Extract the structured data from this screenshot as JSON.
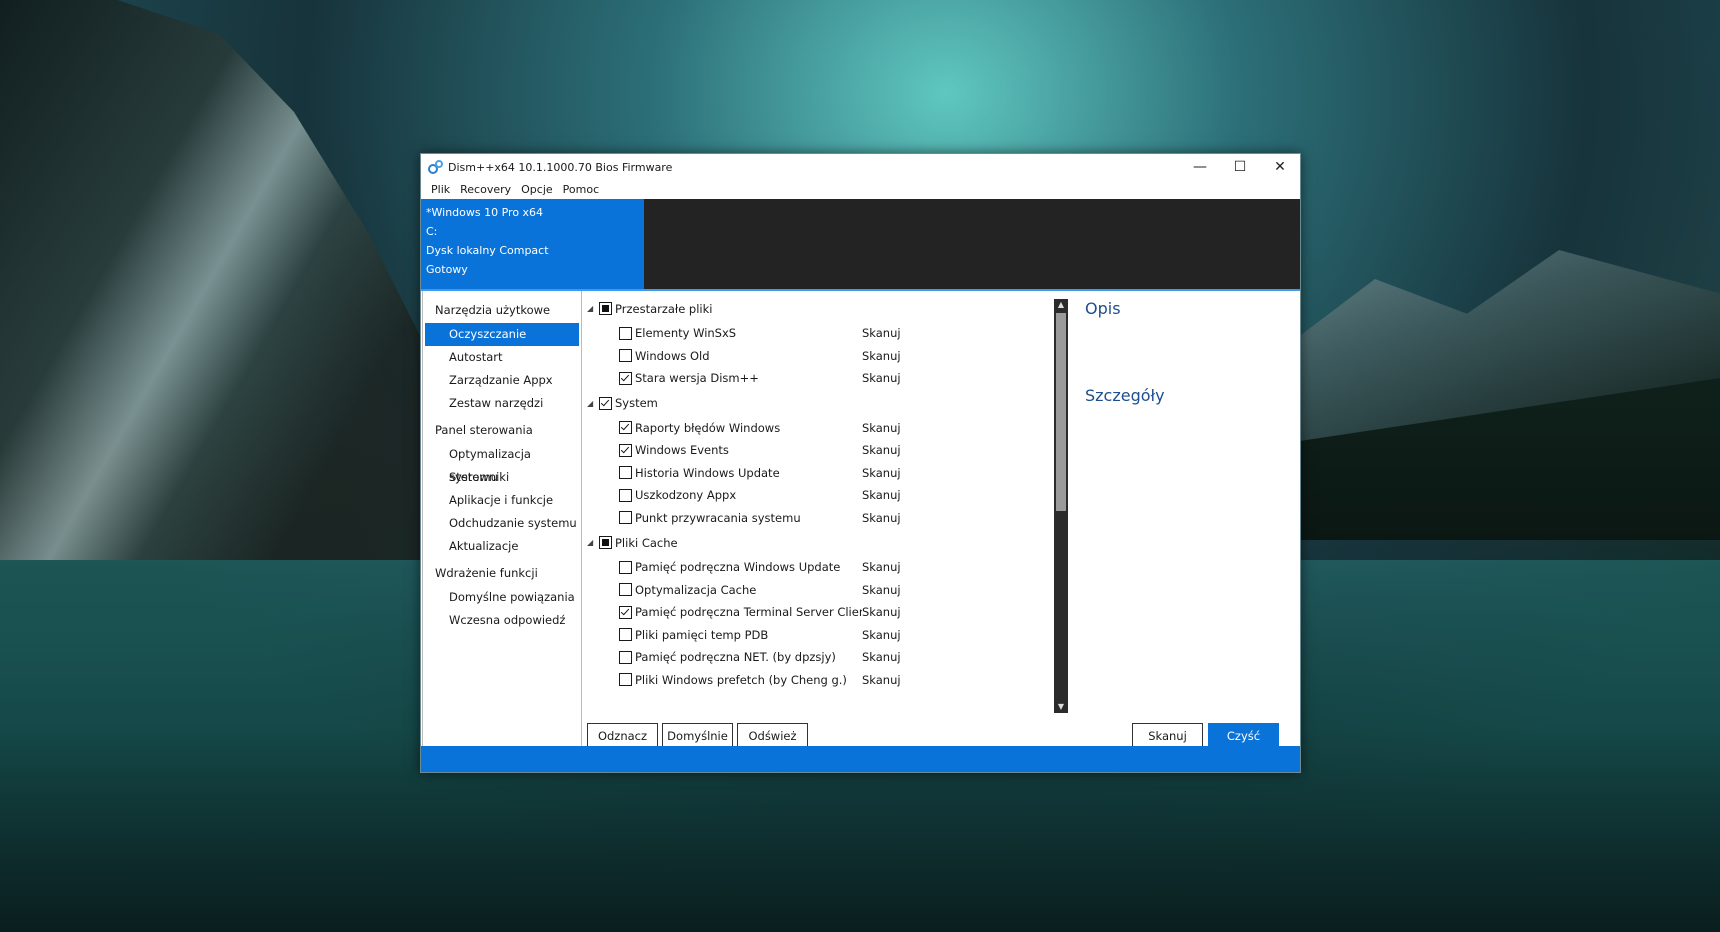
{
  "window": {
    "title": "Dism++x64 10.1.1000.70 Bios Firmware",
    "controls": {
      "minimize": "—",
      "maximize": "☐",
      "close": "✕"
    }
  },
  "menu": [
    "Plik",
    "Recovery",
    "Opcje",
    "Pomoc"
  ],
  "header": {
    "os": "*Windows 10 Pro x64",
    "drive": "C:",
    "disk": "Dysk lokalny Compact",
    "status": "Gotowy"
  },
  "sidebar": {
    "groups": [
      {
        "title": "Narzędzia użytkowe",
        "items": [
          "Oczyszczanie",
          "Autostart",
          "Zarządzanie Appx",
          "Zestaw narzędzi"
        ]
      },
      {
        "title": "Panel sterowania",
        "items": [
          "Optymalizacja systemu",
          "Sterowniki",
          "Aplikacje i funkcje",
          "Odchudzanie systemu",
          "Aktualizacje"
        ]
      },
      {
        "title": "Wdrażenie funkcji",
        "items": [
          "Domyślne powiązania",
          "Wczesna odpowiedź"
        ]
      }
    ],
    "active": "Oczyszczanie"
  },
  "cleanup": {
    "categories": [
      {
        "name": "Przestarzałe pliki",
        "state": "partial",
        "items": [
          {
            "label": "Elementy WinSxS",
            "checked": false,
            "action": "Skanuj"
          },
          {
            "label": "Windows Old",
            "checked": false,
            "action": "Skanuj"
          },
          {
            "label": "Stara wersja Dism++",
            "checked": true,
            "action": "Skanuj"
          }
        ]
      },
      {
        "name": "System",
        "state": "checked",
        "items": [
          {
            "label": "Raporty błędów Windows",
            "checked": true,
            "action": "Skanuj"
          },
          {
            "label": "Windows Events",
            "checked": true,
            "action": "Skanuj"
          },
          {
            "label": "Historia Windows Update",
            "checked": false,
            "action": "Skanuj"
          },
          {
            "label": "Uszkodzony Appx",
            "checked": false,
            "action": "Skanuj"
          },
          {
            "label": "Punkt przywracania systemu",
            "checked": false,
            "action": "Skanuj"
          }
        ]
      },
      {
        "name": "Pliki Cache",
        "state": "partial",
        "items": [
          {
            "label": "Pamięć podręczna Windows Update",
            "checked": false,
            "action": "Skanuj"
          },
          {
            "label": "Optymalizacja Cache",
            "checked": false,
            "action": "Skanuj"
          },
          {
            "label": "Pamięć podręczna Terminal Server Client",
            "checked": true,
            "action": "Skanuj"
          },
          {
            "label": "Pliki pamięci temp PDB",
            "checked": false,
            "action": "Skanuj"
          },
          {
            "label": "Pamięć podręczna NET. (by dpzsjy)",
            "checked": false,
            "action": "Skanuj"
          },
          {
            "label": "Pliki Windows prefetch (by Cheng g.)",
            "checked": false,
            "action": "Skanuj"
          }
        ]
      }
    ]
  },
  "buttons": {
    "uncheck": "Odznacz",
    "defaults": "Domyślnie",
    "refresh": "Odśwież",
    "scan": "Skanuj",
    "clean": "Czyść"
  },
  "details": {
    "description": "Opis",
    "details": "Szczegóły"
  },
  "colors": {
    "accent": "#0a73d9",
    "header_dark": "#232323",
    "link": "#1d4e8e"
  }
}
